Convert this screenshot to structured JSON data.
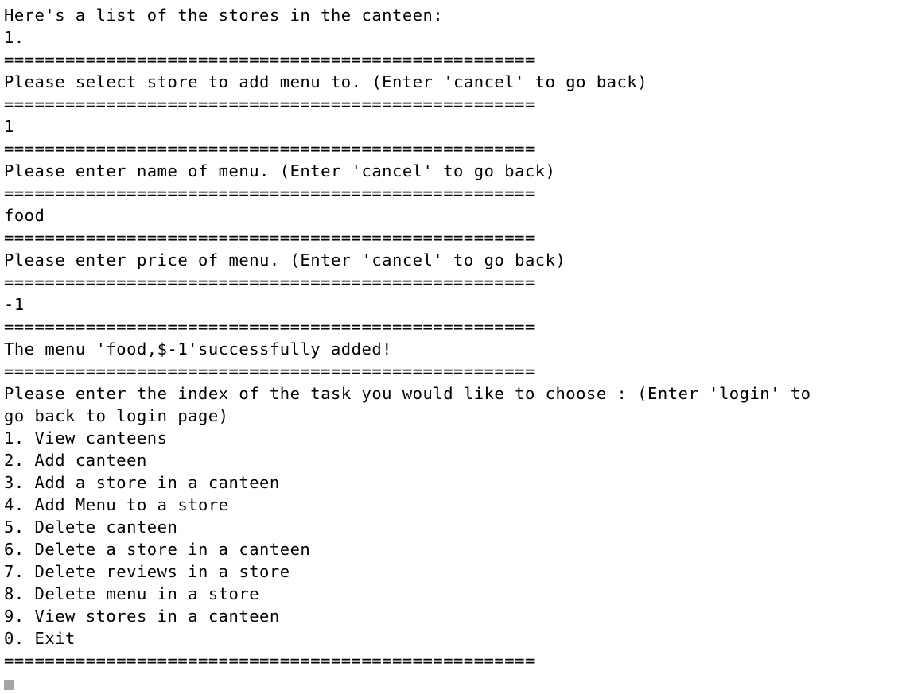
{
  "terminal": {
    "lines": [
      "Here's a list of the stores in the canteen:",
      "1.",
      "====================================================",
      "Please select store to add menu to. (Enter 'cancel' to go back)",
      "====================================================",
      "1",
      "====================================================",
      "Please enter name of menu. (Enter 'cancel' to go back)",
      "====================================================",
      "food",
      "====================================================",
      "Please enter price of menu. (Enter 'cancel' to go back)",
      "====================================================",
      "-1",
      "====================================================",
      "The menu 'food,$-1'successfully added!",
      "====================================================",
      "Please enter the index of the task you would like to choose : (Enter 'login' to",
      "go back to login page)",
      "1. View canteens",
      "2. Add canteen",
      "3. Add a store in a canteen",
      "4. Add Menu to a store",
      "5. Delete canteen",
      "6. Delete a store in a canteen",
      "7. Delete reviews in a store",
      "8. Delete menu in a store",
      "9. View stores in a canteen",
      "0. Exit",
      "===================================================="
    ],
    "cursor_color": "#a6a6a6",
    "background_color": "#ffffff",
    "text_color": "#000000"
  }
}
